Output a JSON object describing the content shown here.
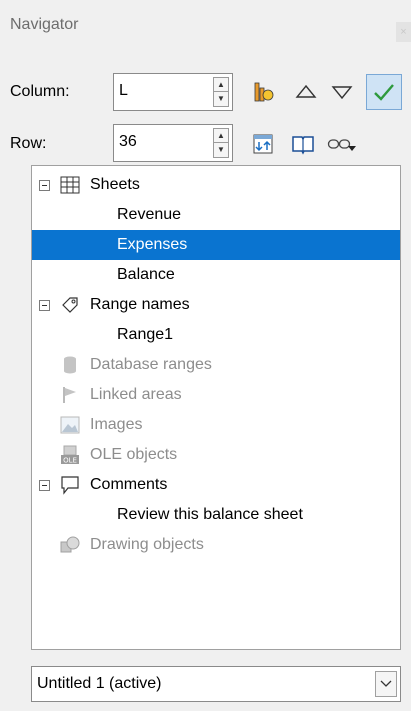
{
  "window": {
    "title": "Navigator"
  },
  "controls": {
    "column": {
      "label": "Column:",
      "value": "L"
    },
    "row": {
      "label": "Row:",
      "value": "36"
    }
  },
  "toolbar": {
    "icons": [
      "content-view-icon",
      "previous-icon",
      "next-icon",
      "confirm-icon",
      "toggle-icon",
      "scenarios-icon",
      "drag-mode-icon",
      "drag-mode-dropdown-icon"
    ]
  },
  "tree": {
    "categories": {
      "sheets": {
        "label": "Sheets",
        "items": [
          "Revenue",
          "Expenses",
          "Balance"
        ]
      },
      "range_names": {
        "label": "Range names",
        "items": [
          "Range1"
        ]
      },
      "database_ranges": {
        "label": "Database ranges"
      },
      "linked_areas": {
        "label": "Linked areas"
      },
      "images": {
        "label": "Images"
      },
      "ole_objects": {
        "label": "OLE objects"
      },
      "comments": {
        "label": "Comments",
        "items": [
          "Review this balance sheet"
        ]
      },
      "drawing_objects": {
        "label": "Drawing objects"
      }
    },
    "selected": "Expenses"
  },
  "document_selector": {
    "value": "Untitled 1 (active)"
  },
  "colors": {
    "selection": "#0a74d0",
    "confirm": "#2e9a3d"
  }
}
